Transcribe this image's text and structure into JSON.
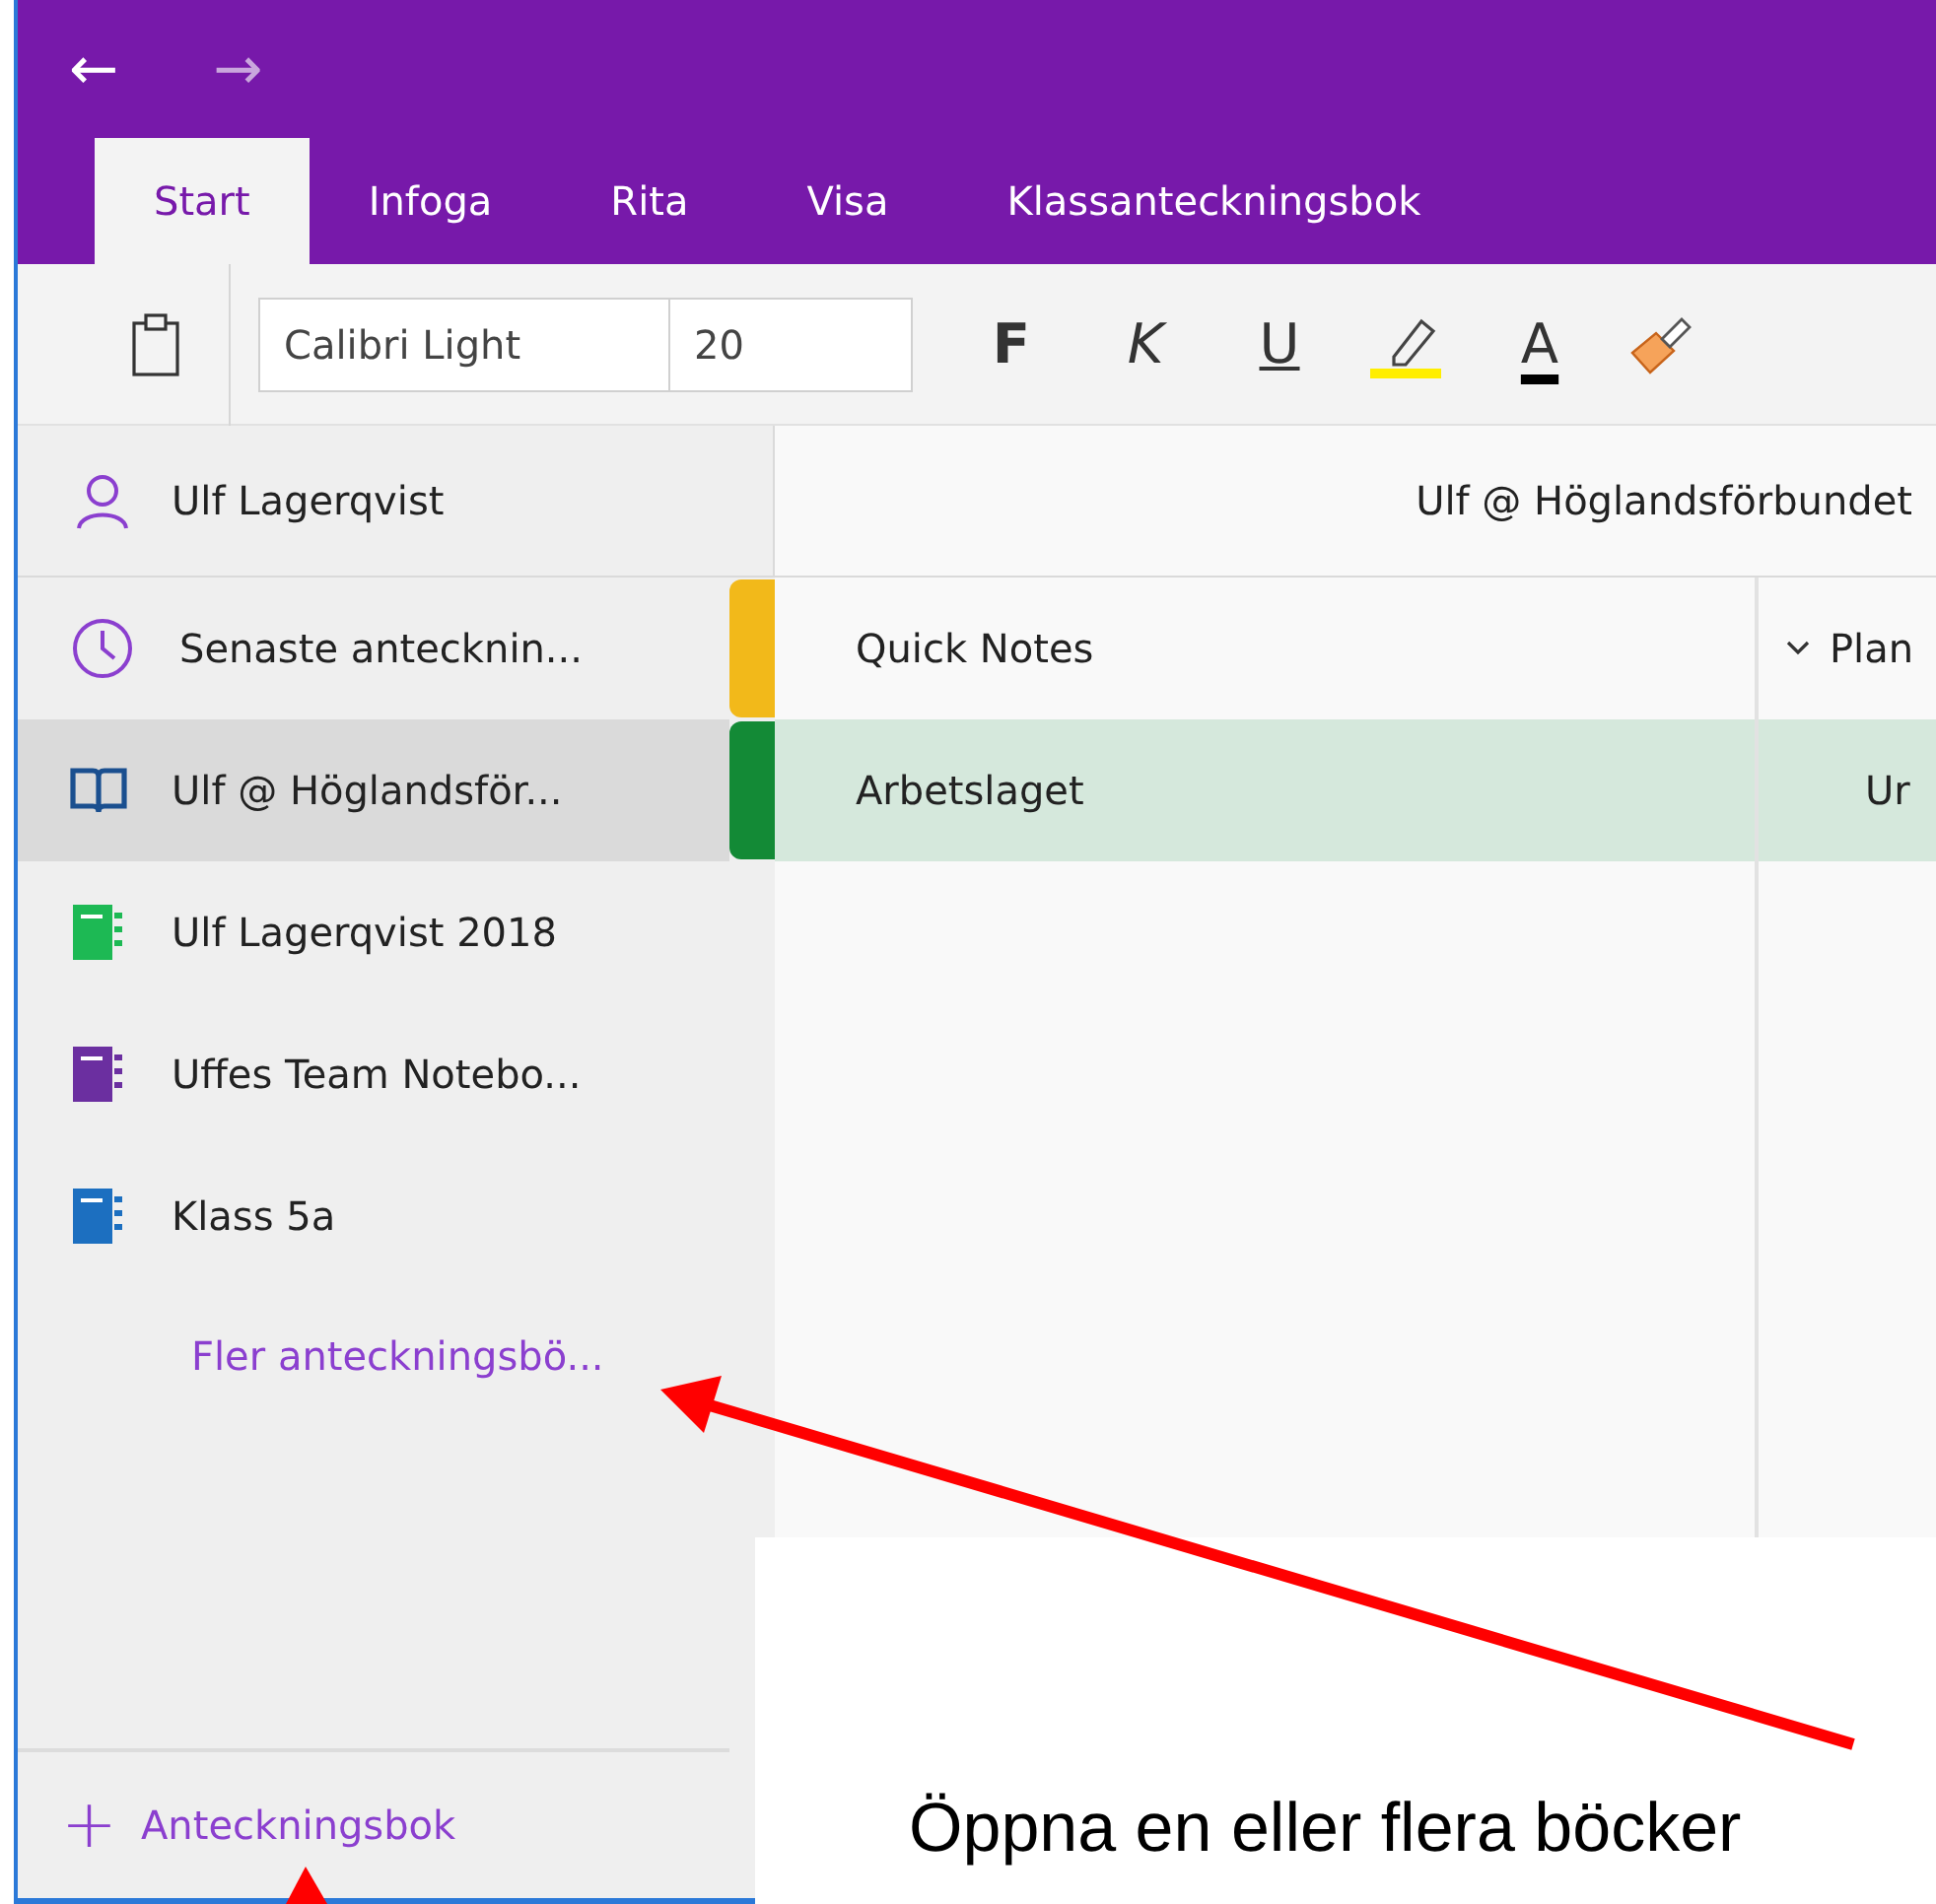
{
  "nav": {
    "back": "←",
    "forward": "→"
  },
  "tabs": [
    {
      "label": "Start",
      "selected": true
    },
    {
      "label": "Infoga",
      "selected": false
    },
    {
      "label": "Rita",
      "selected": false
    },
    {
      "label": "Visa",
      "selected": false
    },
    {
      "label": "Klassanteckningsbok",
      "selected": false
    }
  ],
  "toolbar": {
    "font_name": "Calibri Light",
    "font_size": "20",
    "bold": "F",
    "italic": "K",
    "underline": "U",
    "font_color": "A"
  },
  "user": {
    "name": "Ulf Lagerqvist"
  },
  "notebook_title": "Ulf @ Höglandsförbundet",
  "notebooks": [
    {
      "display": "Senaste antecknin...",
      "kind": "recent",
      "selected": false
    },
    {
      "display": "Ulf @ Höglandsför...",
      "kind": "current",
      "selected": true
    },
    {
      "display": "Ulf Lagerqvist 2018",
      "kind": "notebook",
      "color": "#1db954",
      "selected": false
    },
    {
      "display": "Uffes Team Notebo...",
      "kind": "notebook",
      "color": "#6b2fa0",
      "selected": false
    },
    {
      "display": "Klass 5a",
      "kind": "notebook",
      "color": "#1c6fc0",
      "selected": false
    }
  ],
  "more_notebooks": "Fler anteckningsbö...",
  "add_notebook": {
    "icon": "+",
    "label": "Anteckningsbok"
  },
  "sections": [
    {
      "label": "Quick Notes",
      "color": "#f2b91a",
      "selected": false
    },
    {
      "label": "Arbetslaget",
      "color": "#138a36",
      "selected": true
    }
  ],
  "pages": [
    {
      "label": "Plan",
      "kind": "group",
      "selected": false
    },
    {
      "label": "Ur",
      "kind": "page",
      "selected": true
    }
  ],
  "callout": {
    "text": "Öppna en eller flera böcker"
  }
}
